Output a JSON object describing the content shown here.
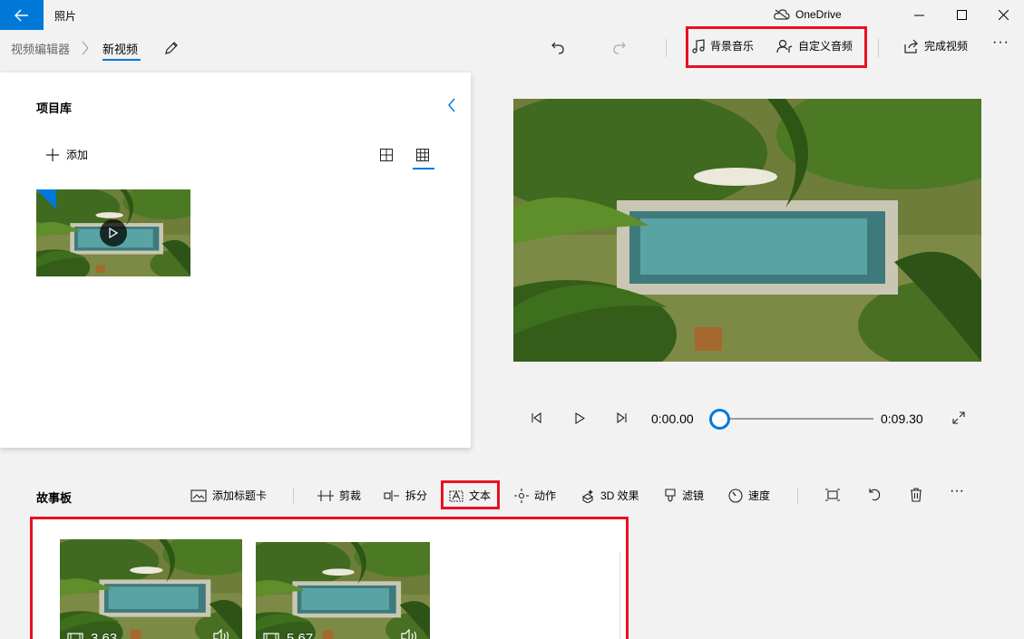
{
  "titlebar": {
    "app_title": "照片",
    "onedrive_label": "OneDrive"
  },
  "toolbar": {
    "breadcrumb_parent": "视频编辑器",
    "breadcrumb_current": "新视频",
    "background_music_label": "背景音乐",
    "custom_audio_label": "自定义音频",
    "finish_video_label": "完成视频",
    "more_label": "···"
  },
  "library": {
    "title": "项目库",
    "add_label": "添加"
  },
  "player": {
    "current_time": "0:00.00",
    "total_time": "0:09.30",
    "progress": 0
  },
  "storyboard": {
    "title": "故事板",
    "tools": [
      {
        "label": "添加标题卡"
      },
      {
        "label": "剪裁"
      },
      {
        "label": "拆分"
      },
      {
        "label": "文本"
      },
      {
        "label": "动作"
      },
      {
        "label": "3D 效果"
      },
      {
        "label": "滤镜"
      },
      {
        "label": "速度"
      }
    ],
    "more_label": "···",
    "clips": [
      {
        "duration": "3.63"
      },
      {
        "duration": "5.67"
      }
    ]
  },
  "colors": {
    "accent": "#0078d7",
    "highlight_box": "#e81123"
  }
}
